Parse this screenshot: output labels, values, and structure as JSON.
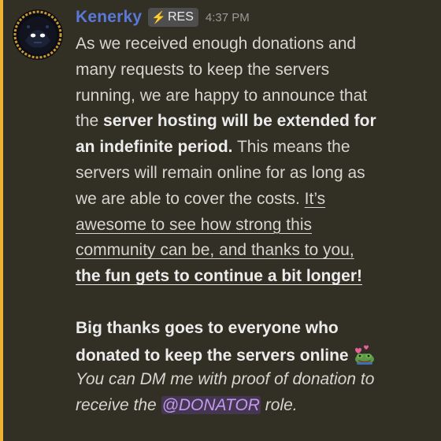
{
  "message": {
    "author": "Kenerky",
    "role_tag": {
      "icon": "lightning-bolt-icon",
      "label": "RES"
    },
    "timestamp": "4:37 PM",
    "paragraph1": {
      "line1": "As we received enough donations and",
      "line2": "many requests to keep the servers",
      "line3": "running, we are happy to announce that",
      "line4_prefix": "the ",
      "line4_bold": "server hosting will be extended for",
      "line5_bold": "an indefinite period.",
      "line5_suffix": " This means the",
      "line6": "servers will remain online for as long as",
      "line7_prefix": "we are able to cover the costs. ",
      "line7_underline": "It’s",
      "line8_underline": "awesome to see how strong this",
      "line9_underline": "community can be, and thanks to you,",
      "line10_bold_underline": "the fun gets to continue a bit longer!"
    },
    "paragraph2": {
      "line1_bold": "Big thanks goes to everyone who",
      "line2_bold": "donated to keep the servers online",
      "emoji": "pepe-hearts-emoji",
      "line3_italic": "You can DM me with proof of donation to",
      "line4_italic_prefix": "receive the ",
      "mention": "@DONATOR",
      "line4_italic_suffix": " role."
    }
  },
  "colors": {
    "background": "#322f25",
    "highlight_bar": "#f0b232",
    "username": "#5a78d8",
    "text": "#d6d6d0",
    "mention": "#c598f0"
  }
}
